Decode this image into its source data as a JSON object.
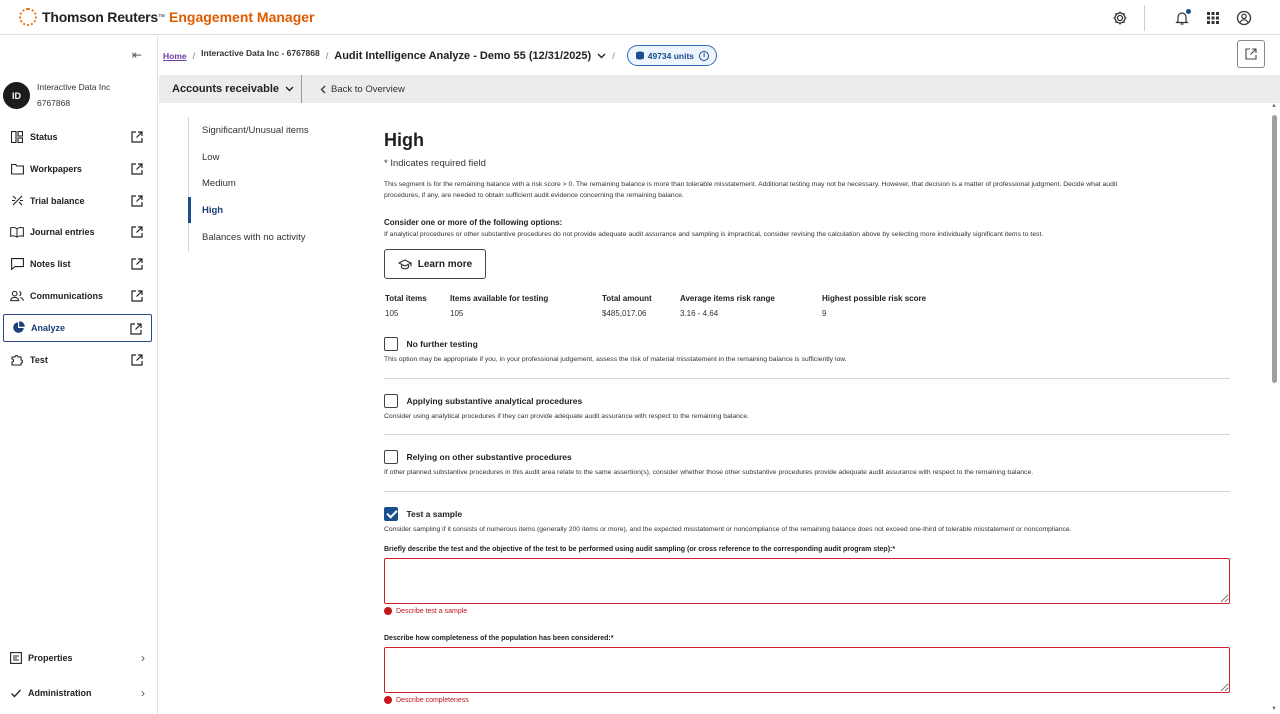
{
  "app": {
    "brand_name": "Thomson Reuters",
    "brand_tm": "™",
    "product_name": "Engagement Manager"
  },
  "topbar": {
    "icons": [
      "gear-icon",
      "bell-icon",
      "apps-grid-icon",
      "account-icon"
    ]
  },
  "sidebar": {
    "collapse_icon": "collapse-left-icon",
    "client_initials": "ID",
    "client_name": "Interactive Data Inc",
    "client_id": "6767868",
    "items": [
      {
        "label": "Status",
        "icon": "status-grid-icon"
      },
      {
        "label": "Workpapers",
        "icon": "folder-icon"
      },
      {
        "label": "Trial balance",
        "icon": "scale-icon"
      },
      {
        "label": "Journal entries",
        "icon": "book-icon"
      },
      {
        "label": "Notes list",
        "icon": "note-icon"
      },
      {
        "label": "Communications",
        "icon": "people-icon"
      },
      {
        "label": "Analyze",
        "icon": "pie-chart-icon",
        "active": true
      },
      {
        "label": "Test",
        "icon": "puzzle-icon"
      }
    ],
    "bottom": [
      {
        "label": "Properties",
        "icon": "properties-icon"
      },
      {
        "label": "Administration",
        "icon": "check-icon"
      }
    ]
  },
  "breadcrumb": {
    "home": "Home",
    "client": "Interactive Data Inc - 6767868",
    "engagement": "Audit Intelligence Analyze - Demo 55 (12/31/2025)",
    "units": "49734 units"
  },
  "subheader": {
    "area": "Accounts receivable",
    "back": "Back to Overview"
  },
  "section_nav": {
    "items": [
      {
        "label": "Significant/Unusual items"
      },
      {
        "label": "Low"
      },
      {
        "label": "Medium"
      },
      {
        "label": "High",
        "active": true
      },
      {
        "label": "Balances with no activity"
      }
    ]
  },
  "main": {
    "title": "High",
    "required_note": "* Indicates required field",
    "intro_line1": "This segment is for the remaining balance with a risk score > 0. The remaining balance is more than tolerable misstatement. Additional testing may not be necessary. However, that decision is a matter of professional judgment. Decide what audit",
    "intro_line2": "procedures, if any, are needed to obtain sufficient audit evidence concerning the remaining balance.",
    "consider_heading": "Consider one or more of the following options:",
    "consider_text": "If analytical procedures or other substantive procedures do not provide adequate audit assurance and sampling is impractical, consider revising the calculation above by selecting more individually significant items to test.",
    "learn_more": "Learn more",
    "stats": [
      {
        "label": "Total items",
        "value": "105"
      },
      {
        "label": "Items available for testing",
        "value": "105"
      },
      {
        "label": "Total amount",
        "value": "$485,017.06"
      },
      {
        "label": "Average items risk range",
        "value": "3.16 - 4.64"
      },
      {
        "label": "Highest possible risk score",
        "value": "9"
      }
    ],
    "options": [
      {
        "title": "No further testing",
        "desc": "This option may be appropriate if you, in your professional judgement, assess the risk of material misstatement in the remaining balance is sufficiently low.",
        "checked": false
      },
      {
        "title": "Applying substantive analytical procedures",
        "desc": "Consider using analytical procedures if they can provide adequate audit assurance with respect to the remaining balance.",
        "checked": false
      },
      {
        "title": "Relying on other substantive procedures",
        "desc": "If other planned substantive procedures in this audit area relate to the same assertion(s), consider whether those other substantive procedures provide adequate audit assurance with respect to the remaining balance.",
        "checked": false
      },
      {
        "title": "Test a sample",
        "desc": "Consider sampling if it consists of numerous items (generally 200 items or more), and the expected misstatement or noncompliance of the remaining balance does not exceed one-third of tolerable misstatement or noncompliance.",
        "checked": true
      }
    ],
    "field1_label": "Briefly describe the test and the objective of the test to be performed using audit sampling (or cross reference to the corresponding audit program step):*",
    "field1_value": "",
    "field1_error": "Describe test a sample",
    "field2_label": "Describe how completeness of the population has been considered:*",
    "field2_value": "",
    "field2_error": "Describe completeness"
  }
}
